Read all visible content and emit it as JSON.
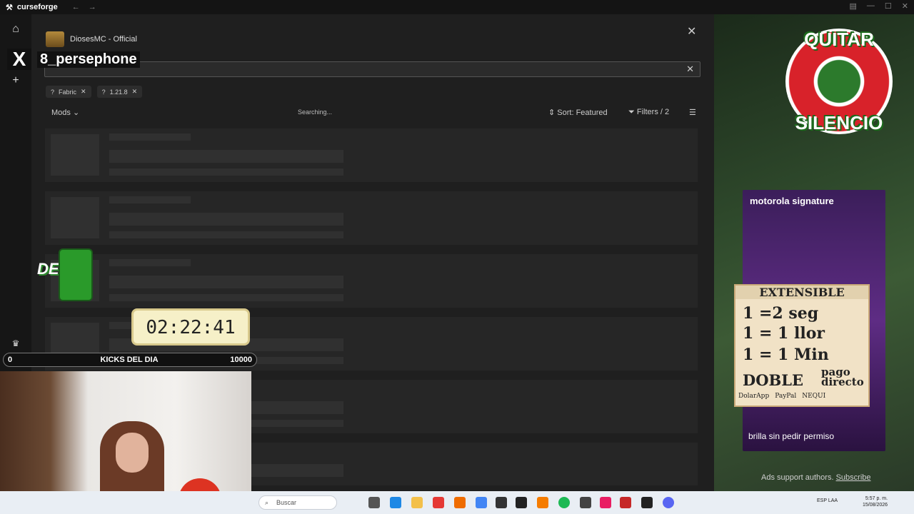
{
  "app": {
    "name": "curseforge"
  },
  "modpack": {
    "name": "DiosesMC - Official"
  },
  "search": {
    "placeholder": ""
  },
  "filters": {
    "chips": [
      "Fabric",
      "1.21.8"
    ]
  },
  "toolbar": {
    "category": "Mods",
    "status": "Searching...",
    "sort": "Sort: Featured",
    "filters": "Filters / 2"
  },
  "overlay": {
    "handle": "8_persephone",
    "badge_top": "QUITAR",
    "badge_bottom": "SILENCIO",
    "de": "DE",
    "timer": "02:22:41",
    "kicks": {
      "min": "0",
      "title": "KICKS DEL DIA",
      "max": "10000"
    },
    "extensible": {
      "title": "EXTENSIBLE",
      "line1": "1   =2 seg",
      "line2": "1   = 1 llor",
      "line3": "1   = 1 Min",
      "doble": "DOBLE",
      "pago": "pago directo",
      "pay1": "DolarApp",
      "pay2": "PayPal",
      "pay3": "NEQUI"
    }
  },
  "ad": {
    "brand": "motorola signature",
    "tagline": "brilla sin pedir permiso",
    "support_text": "Ads support authors.",
    "subscribe": "Subscribe"
  },
  "taskbar": {
    "search_placeholder": "Buscar",
    "time": "5:57 p. m.",
    "date": "15/08/2026",
    "lang": "ESP LAA"
  }
}
